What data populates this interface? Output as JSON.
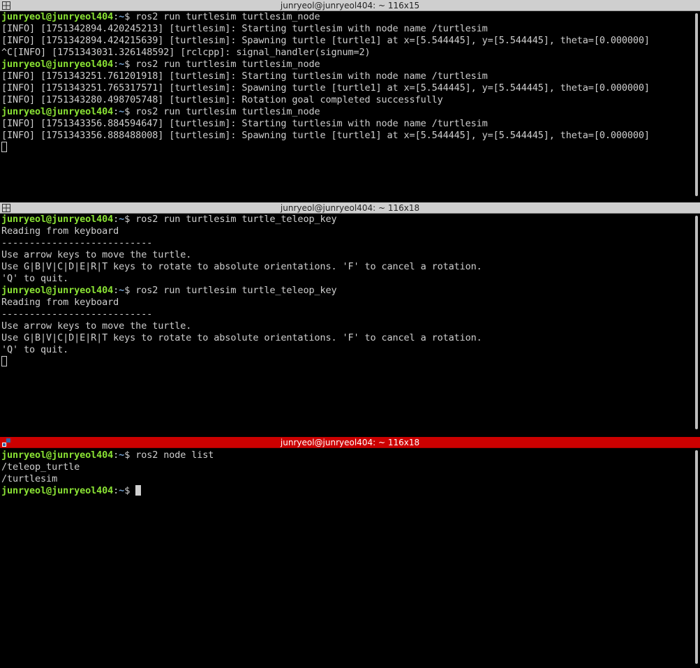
{
  "panes": [
    {
      "title": "junryeol@junryeol404: ~ 116x15",
      "lines": [
        {
          "type": "prompt",
          "user": "junryeol@junryeol404",
          "path": "~",
          "symbol": "$",
          "cmd": " ros2 run turtlesim turtlesim_node"
        },
        {
          "type": "text",
          "text": "[INFO] [1751342894.420245213] [turtlesim]: Starting turtlesim with node name /turtlesim"
        },
        {
          "type": "text",
          "text": "[INFO] [1751342894.424215639] [turtlesim]: Spawning turtle [turtle1] at x=[5.544445], y=[5.544445], theta=[0.000000]"
        },
        {
          "type": "text",
          "text": "^C[INFO] [1751343031.326148592] [rclcpp]: signal_handler(signum=2)"
        },
        {
          "type": "prompt",
          "user": "junryeol@junryeol404",
          "path": "~",
          "symbol": "$",
          "cmd": " ros2 run turtlesim turtlesim_node"
        },
        {
          "type": "text",
          "text": "[INFO] [1751343251.761201918] [turtlesim]: Starting turtlesim with node name /turtlesim"
        },
        {
          "type": "text",
          "text": "[INFO] [1751343251.765317571] [turtlesim]: Spawning turtle [turtle1] at x=[5.544445], y=[5.544445], theta=[0.000000]"
        },
        {
          "type": "text",
          "text": "[INFO] [1751343280.498705748] [turtlesim]: Rotation goal completed successfully"
        },
        {
          "type": "prompt",
          "user": "junryeol@junryeol404",
          "path": "~",
          "symbol": "$",
          "cmd": " ros2 run turtlesim turtlesim_node"
        },
        {
          "type": "text",
          "text": "[INFO] [1751343356.884594647] [turtlesim]: Starting turtlesim with node name /turtlesim"
        },
        {
          "type": "text",
          "text": "[INFO] [1751343356.888488008] [turtlesim]: Spawning turtle [turtle1] at x=[5.544445], y=[5.544445], theta=[0.000000]"
        },
        {
          "type": "cursor",
          "style": "outline"
        }
      ]
    },
    {
      "title": "junryeol@junryeol404: ~ 116x18",
      "lines": [
        {
          "type": "prompt",
          "user": "junryeol@junryeol404",
          "path": "~",
          "symbol": "$",
          "cmd": " ros2 run turtlesim turtle_teleop_key"
        },
        {
          "type": "text",
          "text": "Reading from keyboard"
        },
        {
          "type": "text",
          "text": "---------------------------"
        },
        {
          "type": "text",
          "text": "Use arrow keys to move the turtle."
        },
        {
          "type": "text",
          "text": "Use G|B|V|C|D|E|R|T keys to rotate to absolute orientations. 'F' to cancel a rotation."
        },
        {
          "type": "text",
          "text": "'Q' to quit."
        },
        {
          "type": "prompt",
          "user": "junryeol@junryeol404",
          "path": "~",
          "symbol": "$",
          "cmd": " ros2 run turtlesim turtle_teleop_key"
        },
        {
          "type": "text",
          "text": "Reading from keyboard"
        },
        {
          "type": "text",
          "text": "---------------------------"
        },
        {
          "type": "text",
          "text": "Use arrow keys to move the turtle."
        },
        {
          "type": "text",
          "text": "Use G|B|V|C|D|E|R|T keys to rotate to absolute orientations. 'F' to cancel a rotation."
        },
        {
          "type": "text",
          "text": "'Q' to quit."
        },
        {
          "type": "cursor",
          "style": "outline"
        }
      ]
    },
    {
      "title": "junryeol@junryeol404: ~ 116x18",
      "lines": [
        {
          "type": "prompt",
          "user": "junryeol@junryeol404",
          "path": "~",
          "symbol": "$",
          "cmd": " ros2 node list"
        },
        {
          "type": "text",
          "text": "/teleop_turtle"
        },
        {
          "type": "text",
          "text": "/turtlesim"
        },
        {
          "type": "prompt",
          "user": "junryeol@junryeol404",
          "path": "~",
          "symbol": "$",
          "cmd": " ",
          "cursor": "block"
        }
      ]
    }
  ],
  "colors": {
    "active_titlebar": "#cc0000",
    "inactive_titlebar": "#cfcfcf",
    "prompt_user": "#8ae234",
    "prompt_path": "#729fcf",
    "text": "#cfcfcf",
    "background": "#000000"
  },
  "icons": {
    "inactive": "terminal-split-icon",
    "active": "terminal-active-icon"
  }
}
